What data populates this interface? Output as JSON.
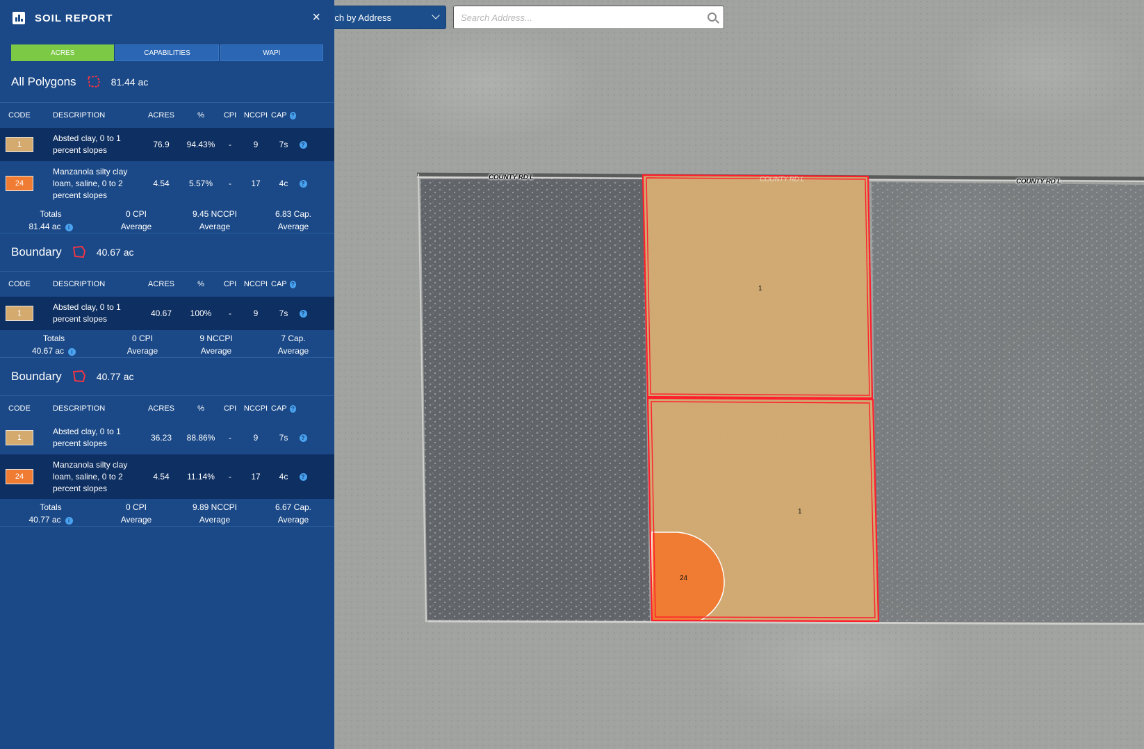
{
  "search": {
    "mode_label": "rch by Address",
    "placeholder": "Search Address..."
  },
  "map": {
    "road_labels": [
      "COUNTY RD L",
      "COUNTY RD L",
      "COUNTY RD L"
    ],
    "parcel_labels": [
      "1",
      "1",
      "24"
    ]
  },
  "sidebar": {
    "title": "SOIL REPORT",
    "close": "×",
    "tabs": [
      {
        "label": "ACRES",
        "active": true
      },
      {
        "label": "CAPABILITIES",
        "active": false
      },
      {
        "label": "WAPI",
        "active": false
      }
    ],
    "columns": {
      "code": "CODE",
      "description": "DESCRIPTION",
      "acres": "ACRES",
      "pct": "%",
      "cpi": "CPI",
      "nccpi": "NCCPI",
      "cap": "CAP"
    },
    "groups": [
      {
        "name": "All Polygons",
        "acres": "81.44 ac",
        "rows": [
          {
            "code": "1",
            "description": "Absted clay, 0 to 1 percent slopes",
            "acres": "76.9",
            "pct": "94.43%",
            "cpi": "-",
            "nccpi": "9",
            "cap": "7s"
          },
          {
            "code": "24",
            "description": "Manzanola silty clay loam, saline, 0 to 2 percent slopes",
            "acres": "4.54",
            "pct": "5.57%",
            "cpi": "-",
            "nccpi": "17",
            "cap": "4c"
          }
        ],
        "totals": {
          "label": "Totals",
          "acres": "81.44 ac",
          "cpi": "0 CPI",
          "nccpi": "9.45 NCCPI",
          "cap": "6.83 Cap.",
          "avg": "Average"
        }
      },
      {
        "name": "Boundary",
        "acres": "40.67 ac",
        "rows": [
          {
            "code": "1",
            "description": "Absted clay, 0 to 1 percent slopes",
            "acres": "40.67",
            "pct": "100%",
            "cpi": "-",
            "nccpi": "9",
            "cap": "7s"
          }
        ],
        "totals": {
          "label": "Totals",
          "acres": "40.67 ac",
          "cpi": "0 CPI",
          "nccpi": "9 NCCPI",
          "cap": "7 Cap.",
          "avg": "Average"
        }
      },
      {
        "name": "Boundary",
        "acres": "40.77 ac",
        "rows": [
          {
            "code": "1",
            "description": "Absted clay, 0 to 1 percent slopes",
            "acres": "36.23",
            "pct": "88.86%",
            "cpi": "-",
            "nccpi": "9",
            "cap": "7s"
          },
          {
            "code": "24",
            "description": "Manzanola silty clay loam, saline, 0 to 2 percent slopes",
            "acres": "4.54",
            "pct": "11.14%",
            "cpi": "-",
            "nccpi": "17",
            "cap": "4c"
          }
        ],
        "totals": {
          "label": "Totals",
          "acres": "40.77 ac",
          "cpi": "0 CPI",
          "nccpi": "9.89 NCCPI",
          "cap": "6.67 Cap.",
          "avg": "Average"
        }
      }
    ]
  },
  "colors": {
    "sidebar_bg": "#1b4987",
    "tab_active": "#7bc944",
    "soil_1": "#d4aa6e",
    "soil_24": "#f07b32",
    "boundary": "#ff1e2d"
  }
}
